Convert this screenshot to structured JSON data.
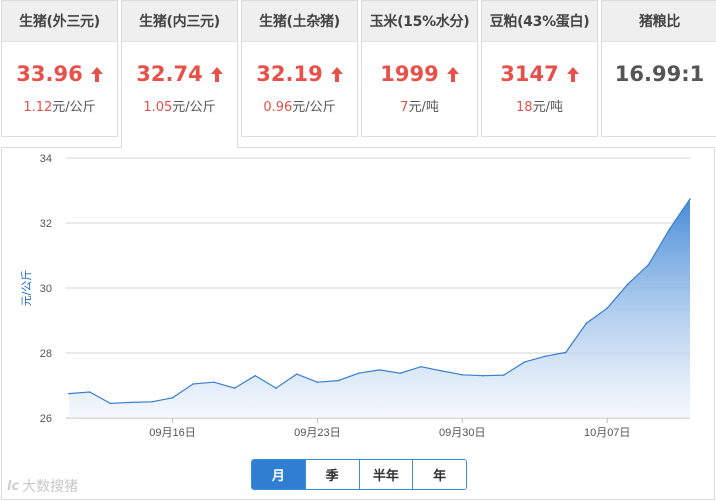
{
  "cards": [
    {
      "title": "生猪(外三元)",
      "price": "33.96",
      "up": true,
      "change_value": "1.12",
      "change_unit": "元/公斤",
      "active": false
    },
    {
      "title": "生猪(内三元)",
      "price": "32.74",
      "up": true,
      "change_value": "1.05",
      "change_unit": "元/公斤",
      "active": true
    },
    {
      "title": "生猪(土杂猪)",
      "price": "32.19",
      "up": true,
      "change_value": "0.96",
      "change_unit": "元/公斤",
      "active": false
    },
    {
      "title": "玉米(15%水分)",
      "price": "1999",
      "up": true,
      "change_value": "7",
      "change_unit": "元/吨",
      "active": false
    },
    {
      "title": "豆粕(43%蛋白)",
      "price": "3147",
      "up": true,
      "change_value": "18",
      "change_unit": "元/吨",
      "active": false
    },
    {
      "title": "猪粮比",
      "price": "16.99:1",
      "up": false,
      "change_value": "",
      "change_unit": "",
      "active": false
    }
  ],
  "range_buttons": [
    {
      "label": "月",
      "active": true
    },
    {
      "label": "季",
      "active": false
    },
    {
      "label": "半年",
      "active": false
    },
    {
      "label": "年",
      "active": false
    }
  ],
  "watermark": {
    "logo": "lc",
    "text": "大数搜猪"
  },
  "colors": {
    "up": "#e8504a",
    "line": "#3a7fcf",
    "area_top": "#3f86d6",
    "area_bottom": "#eef4fb",
    "accent": "#2e7fd2"
  },
  "icons": {
    "up_arrow": "arrow-up-icon"
  },
  "chart_data": {
    "type": "area",
    "ylabel": "元/公斤",
    "xlabel": "",
    "ylim": [
      26,
      34
    ],
    "yticks": [
      26,
      28,
      30,
      32,
      34
    ],
    "xtick_labels": [
      "09月16日",
      "09月23日",
      "09月30日",
      "10月07日"
    ],
    "grid": true,
    "series": [
      {
        "name": "",
        "x": [
          "09月11日",
          "09月12日",
          "09月13日",
          "09月14日",
          "09月15日",
          "09月16日",
          "09月17日",
          "09月18日",
          "09月19日",
          "09月20日",
          "09月21日",
          "09月22日",
          "09月23日",
          "09月24日",
          "09月25日",
          "09月26日",
          "09月27日",
          "09月28日",
          "09月29日",
          "09月30日",
          "10月01日",
          "10月02日",
          "10月03日",
          "10月04日",
          "10月05日",
          "10月06日",
          "10月07日",
          "10月08日",
          "10月09日",
          "10月10日",
          "10月11日"
        ],
        "values": [
          26.75,
          26.8,
          26.45,
          26.48,
          26.5,
          26.62,
          27.05,
          27.1,
          26.92,
          27.3,
          26.92,
          27.35,
          27.1,
          27.15,
          27.38,
          27.48,
          27.38,
          27.58,
          27.45,
          27.33,
          27.3,
          27.32,
          27.72,
          27.9,
          28.02,
          28.92,
          29.38,
          30.12,
          30.72,
          31.8,
          32.74
        ]
      }
    ]
  }
}
